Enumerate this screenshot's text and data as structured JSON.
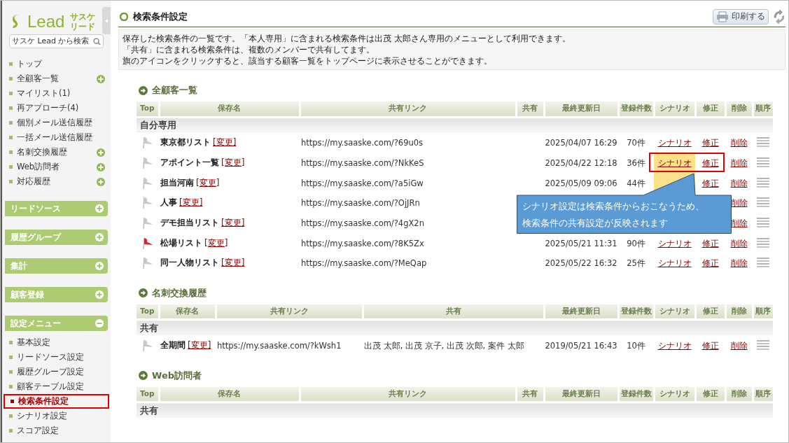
{
  "sidebar": {
    "logo": {
      "wordmark": "Lead",
      "sub_top": "サスケ",
      "sub_bottom": "リード"
    },
    "search": {
      "placeholder": "サスケ Lead から検索"
    },
    "items": [
      {
        "label": "トップ",
        "expandable": false
      },
      {
        "label": "全顧客一覧",
        "expandable": true
      },
      {
        "label": "マイリスト(1)",
        "expandable": false
      },
      {
        "label": "再アプローチ(4)",
        "expandable": false
      },
      {
        "label": "個別メール送信履歴",
        "expandable": false
      },
      {
        "label": "一括メール送信履歴",
        "expandable": false
      },
      {
        "label": "名刺交換履歴",
        "expandable": true
      },
      {
        "label": "Web訪問者",
        "expandable": true
      },
      {
        "label": "対応履歴",
        "expandable": true
      }
    ],
    "sections": [
      {
        "label": "リードソース",
        "expanded": false
      },
      {
        "label": "履歴グループ",
        "expanded": false
      },
      {
        "label": "集計",
        "expanded": false
      },
      {
        "label": "顧客登録",
        "expanded": false
      },
      {
        "label": "設定メニュー",
        "expanded": true,
        "items": [
          {
            "label": "基本設定",
            "selected": false
          },
          {
            "label": "リードソース設定",
            "selected": false
          },
          {
            "label": "履歴グループ設定",
            "selected": false
          },
          {
            "label": "顧客テーブル設定",
            "selected": false
          },
          {
            "label": "検索条件設定",
            "selected": true
          },
          {
            "label": "シナリオ設定",
            "selected": false
          },
          {
            "label": "スコア設定",
            "selected": false
          }
        ]
      }
    ]
  },
  "header": {
    "title": "検索条件設定",
    "print_button": "印刷する"
  },
  "description": [
    "保存した検索条件の一覧です。「本人専用」に含まれる検索条件は出茂 太郎さん専用のメニューとして利用できます。",
    "「共有」に含まれる検索条件は、複数のメンバーで共有してます。",
    "旗のアイコンをクリックすると、該当する顧客一覧をトップページに表示させることができます。"
  ],
  "sections": [
    {
      "title": "全顧客一覧",
      "columns": [
        {
          "kind": "top",
          "label": "Top"
        },
        {
          "kind": "name",
          "label": "保存名"
        },
        {
          "kind": "link",
          "label": "共有リンク"
        },
        {
          "kind": "share",
          "label": "共有"
        },
        {
          "kind": "date",
          "label": "最終更新日"
        },
        {
          "kind": "count",
          "label": "登録件数"
        },
        {
          "kind": "scenario",
          "label": "シナリオ"
        },
        {
          "kind": "modify",
          "label": "修正"
        },
        {
          "kind": "delete",
          "label": "削除"
        },
        {
          "kind": "order",
          "label": "順序"
        }
      ],
      "groups": [
        {
          "label": "自分専用",
          "rows": [
            {
              "flag_on": false,
              "name": "東京都リスト",
              "edit_link": "[変更]",
              "link": "https://my.saaske.com/?69u0s",
              "date": "2025/04/07 16:29",
              "count": "70件",
              "scenario": "シナリオ",
              "modify": "修正",
              "delete": "削除",
              "scenario_highlighted": false,
              "annotated": false
            },
            {
              "flag_on": false,
              "name": "アポイント一覧",
              "edit_link": "[変更]",
              "link": "https://my.saaske.com/?NkKeS",
              "date": "2025/04/22 12:18",
              "count": "36件",
              "scenario": "シナリオ",
              "modify": "修正",
              "delete": "削除",
              "scenario_highlighted": true,
              "annotated": true
            },
            {
              "flag_on": false,
              "name": "担当河南",
              "edit_link": "[変更]",
              "link": "https://my.saaske.com/?a5iGw",
              "date": "2025/05/09 09:06",
              "count": "44件",
              "modify": "修正",
              "delete": "削除",
              "scenario_highlighted": true,
              "annotated": false
            },
            {
              "flag_on": false,
              "name": "人事",
              "edit_link": "[変更]",
              "link": "https://my.saaske.com/?OjJRn",
              "delete": "削除"
            },
            {
              "flag_on": false,
              "name": "デモ担当リスト",
              "edit_link": "[変更]",
              "link": "https://my.saaske.com/?4gX2n",
              "delete": "削除"
            },
            {
              "flag_on": true,
              "name": "松場リスト",
              "edit_link": "[変更]",
              "link": "https://my.saaske.com/?8K5Zx",
              "date": "2025/05/21 11:31",
              "count": "90件",
              "scenario": "シナリオ",
              "modify": "修正",
              "delete": "削除",
              "scenario_highlighted": false,
              "annotated": false
            },
            {
              "flag_on": false,
              "name": "同一人物リスト",
              "edit_link": "[変更]",
              "link": "https://my.saaske.com/?MeQap",
              "date": "2025/05/22 16:32",
              "count": "25件",
              "scenario": "シナリオ",
              "modify": "修正",
              "delete": "削除",
              "scenario_highlighted": false,
              "annotated": false
            }
          ]
        }
      ]
    },
    {
      "title": "名刺交換履歴",
      "columns": [
        {
          "kind": "top",
          "label": "Top"
        },
        {
          "kind": "name",
          "label": "保存名"
        },
        {
          "kind": "link",
          "label": "共有リンク"
        },
        {
          "kind": "share",
          "label": "共有"
        },
        {
          "kind": "date",
          "label": "最終更新日"
        },
        {
          "kind": "count",
          "label": "登録件数"
        },
        {
          "kind": "scenario",
          "label": "シナリオ"
        },
        {
          "kind": "modify",
          "label": "修正"
        },
        {
          "kind": "delete",
          "label": "削除"
        },
        {
          "kind": "order",
          "label": "順序"
        }
      ],
      "groups": [
        {
          "label": "共有",
          "rows": [
            {
              "flag_on": false,
              "name": "全期間",
              "edit_link": "[変更]",
              "link": "https://my.saaske.com/?kWsh1",
              "share": "出茂 太郎, 出茂 京子, 出茂 次郎, 案件 太郎",
              "date": "2019/05/21 16:43",
              "count": "10件",
              "scenario": "シナリオ",
              "modify": "修正",
              "delete": "削除",
              "scenario_highlighted": false,
              "annotated": false
            }
          ]
        }
      ]
    },
    {
      "title": "Web訪問者",
      "columns": [
        {
          "kind": "top",
          "label": "Top"
        },
        {
          "kind": "name",
          "label": "保存名"
        },
        {
          "kind": "link",
          "label": "共有リンク"
        },
        {
          "kind": "share",
          "label": "共有"
        },
        {
          "kind": "date",
          "label": "最終更新日"
        },
        {
          "kind": "count",
          "label": "登録件数"
        },
        {
          "kind": "scenario",
          "label": "シナリオ"
        },
        {
          "kind": "modify",
          "label": "修正"
        },
        {
          "kind": "delete",
          "label": "削除"
        },
        {
          "kind": "order",
          "label": "順序"
        }
      ],
      "groups": [
        {
          "label": "共有"
        }
      ]
    }
  ],
  "callout": {
    "lines": [
      "シナリオ設定は検索条件からおこなうため、",
      "検索条件の共有設定が反映されます"
    ]
  }
}
